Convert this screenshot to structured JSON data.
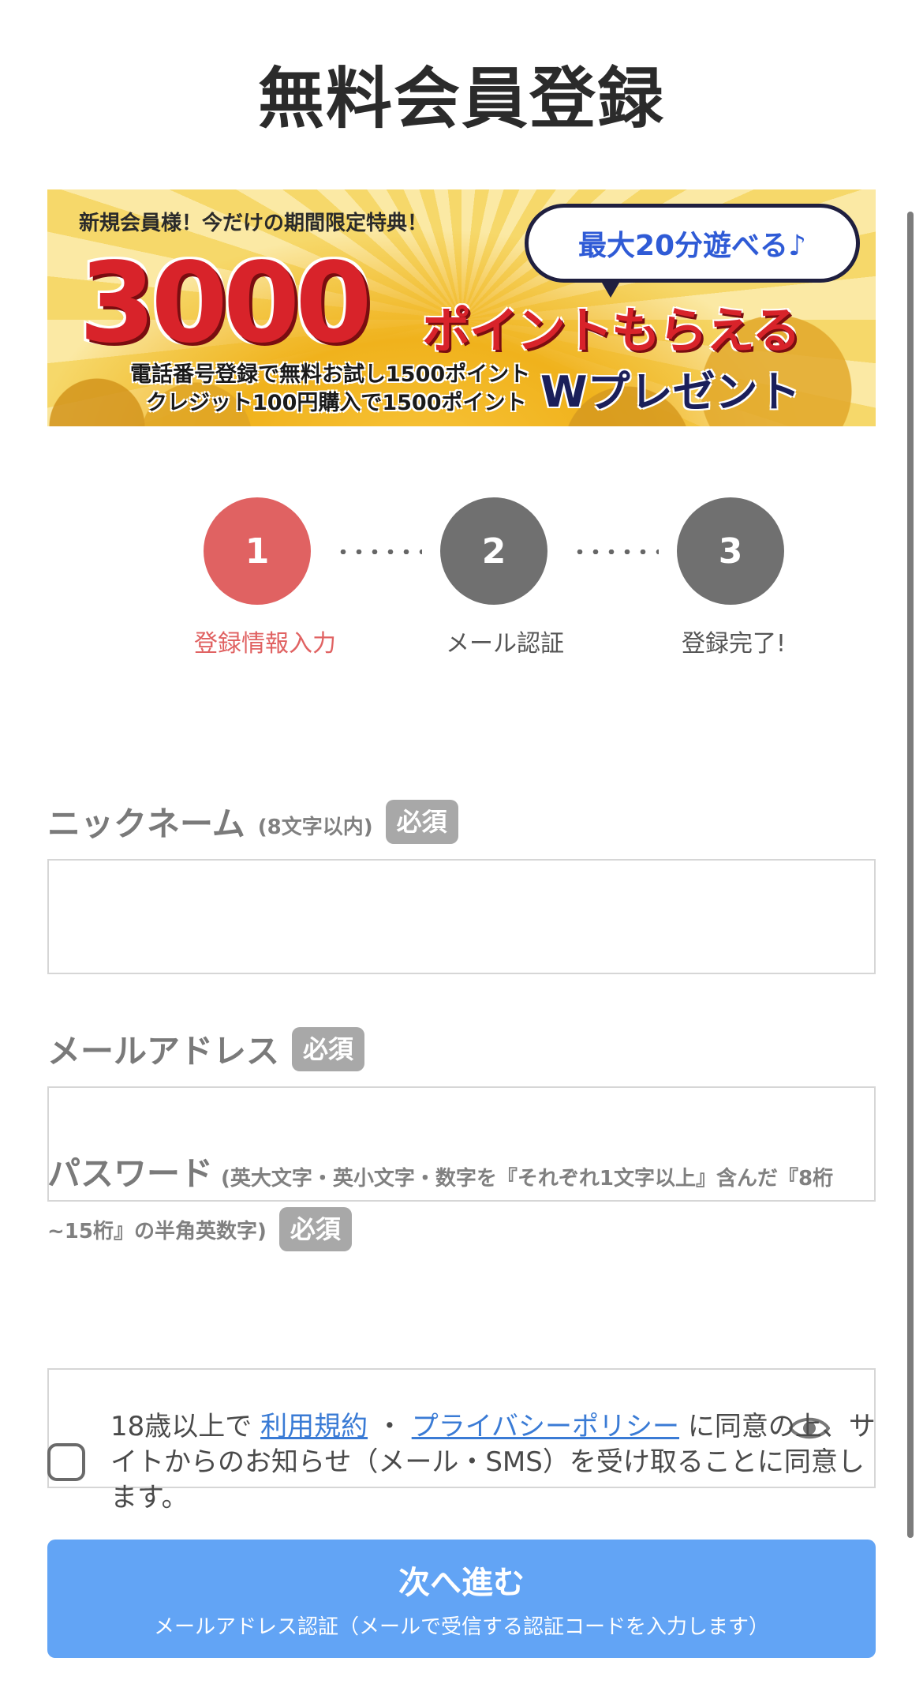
{
  "page": {
    "title": "無料会員登録"
  },
  "banner": {
    "top_text": "新規会員様！今だけの期間限定特典！",
    "bubble_text": "最大20分遊べる♪",
    "big_number": "3000",
    "big_text": "ポイントもらえる",
    "line1": "電話番号登録で無料お試し1500ポイント",
    "line2": "クレジット100円購入で1500ポイント",
    "w_text": "Wプレゼント"
  },
  "steps": [
    {
      "number": "1",
      "label": "登録情報入力",
      "active": true
    },
    {
      "number": "2",
      "label": "メール認証",
      "active": false
    },
    {
      "number": "3",
      "label": "登録完了!",
      "active": false
    }
  ],
  "form": {
    "nickname": {
      "label": "ニックネーム",
      "note": "(8文字以内)",
      "required": "必須",
      "value": ""
    },
    "email": {
      "label": "メールアドレス",
      "required": "必須",
      "value": ""
    },
    "password": {
      "label": "パスワード",
      "note": "(英大文字・英小文字・数字を『それぞれ1文字以上』含んだ『8桁~15桁』の半角英数字)",
      "required": "必須",
      "value": ""
    }
  },
  "agreement": {
    "prefix": "18歳以上で",
    "terms_link": "利用規約",
    "separator": "・",
    "privacy_link": "プライバシーポリシー",
    "suffix": "に同意の上、サイトからのお知らせ（メール・SMS）を受け取ることに同意します。",
    "checked": false
  },
  "submit": {
    "label": "次へ進む",
    "sub_label": "メールアドレス認証（メールで受信する認証コードを入力します）"
  },
  "colors": {
    "accent_active": "#e06262",
    "step_idle": "#707070",
    "button": "#62a4f5",
    "link": "#3a7bd5",
    "badge": "#a8a8a8"
  }
}
